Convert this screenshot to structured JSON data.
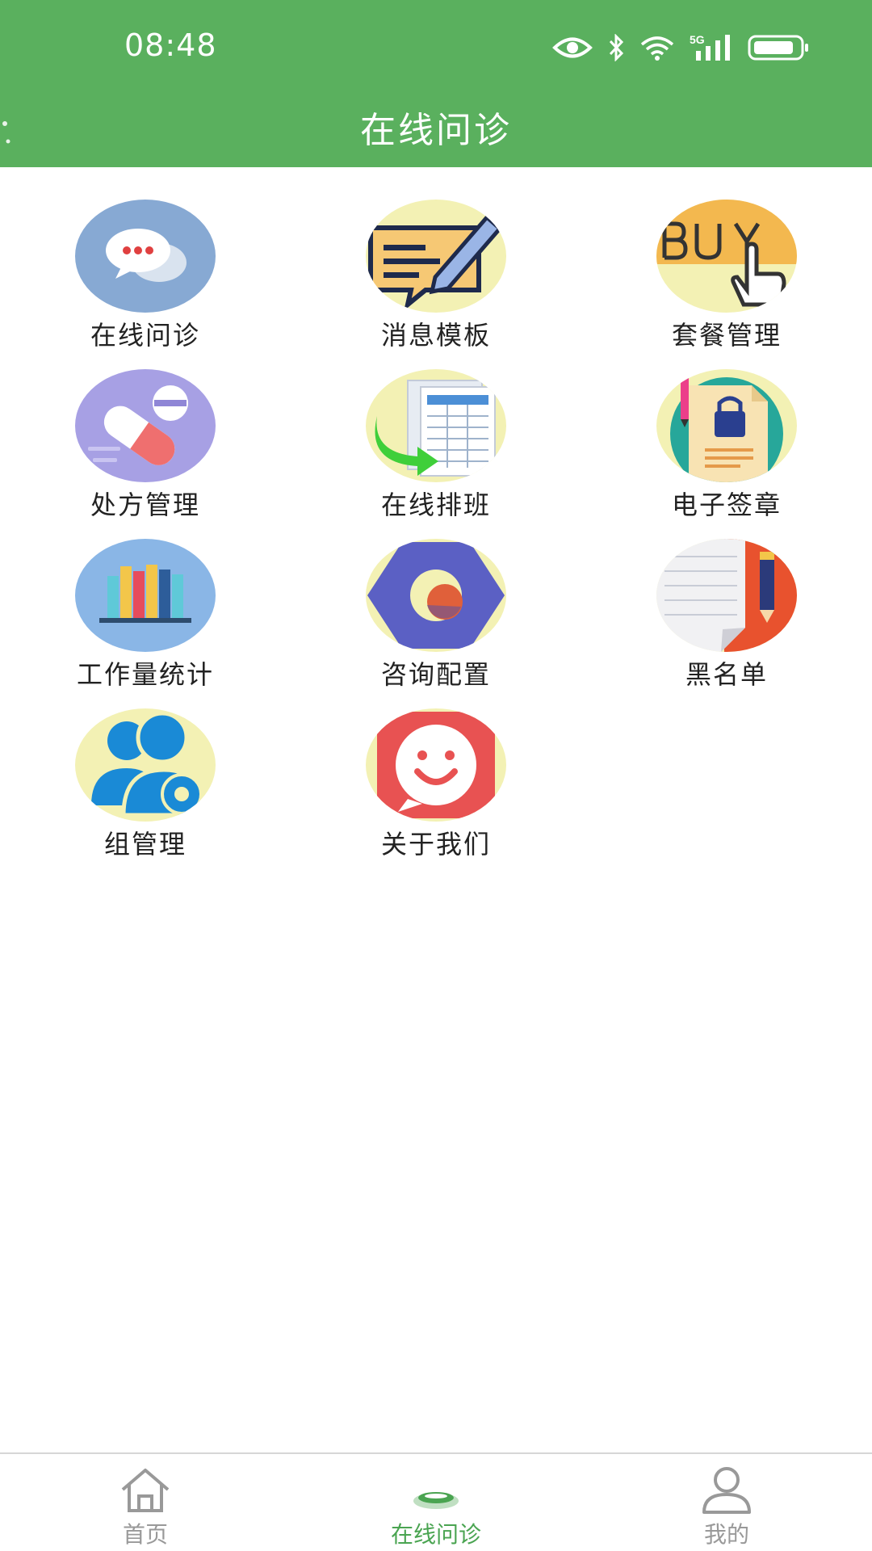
{
  "status_bar": {
    "time": "08:48",
    "icons": [
      "eye-icon",
      "bluetooth-icon",
      "wifi-icon",
      "signal-5g-icon",
      "battery-icon"
    ],
    "network_label": "5G"
  },
  "header": {
    "title": "在线问诊",
    "background_color": "#5ab05e"
  },
  "grid": {
    "items": [
      {
        "label": "在线问诊",
        "icon": "chat-bubbles-icon"
      },
      {
        "label": "消息模板",
        "icon": "message-edit-icon"
      },
      {
        "label": "套餐管理",
        "icon": "buy-hand-icon"
      },
      {
        "label": "处方管理",
        "icon": "pills-icon"
      },
      {
        "label": "在线排班",
        "icon": "schedule-sheet-icon"
      },
      {
        "label": "电子签章",
        "icon": "signed-document-icon"
      },
      {
        "label": "工作量统计",
        "icon": "books-chart-icon"
      },
      {
        "label": "咨询配置",
        "icon": "hex-nut-icon"
      },
      {
        "label": "黑名单",
        "icon": "notebook-pen-icon"
      },
      {
        "label": "组管理",
        "icon": "group-settings-icon"
      },
      {
        "label": "关于我们",
        "icon": "smiley-icon"
      }
    ]
  },
  "bottom_nav": {
    "active_color": "#4aa451",
    "inactive_color": "#999999",
    "items": [
      {
        "label": "首页",
        "icon": "home-icon",
        "active": false
      },
      {
        "label": "在线问诊",
        "icon": "consult-icon",
        "active": true
      },
      {
        "label": "我的",
        "icon": "user-icon",
        "active": false
      }
    ]
  }
}
